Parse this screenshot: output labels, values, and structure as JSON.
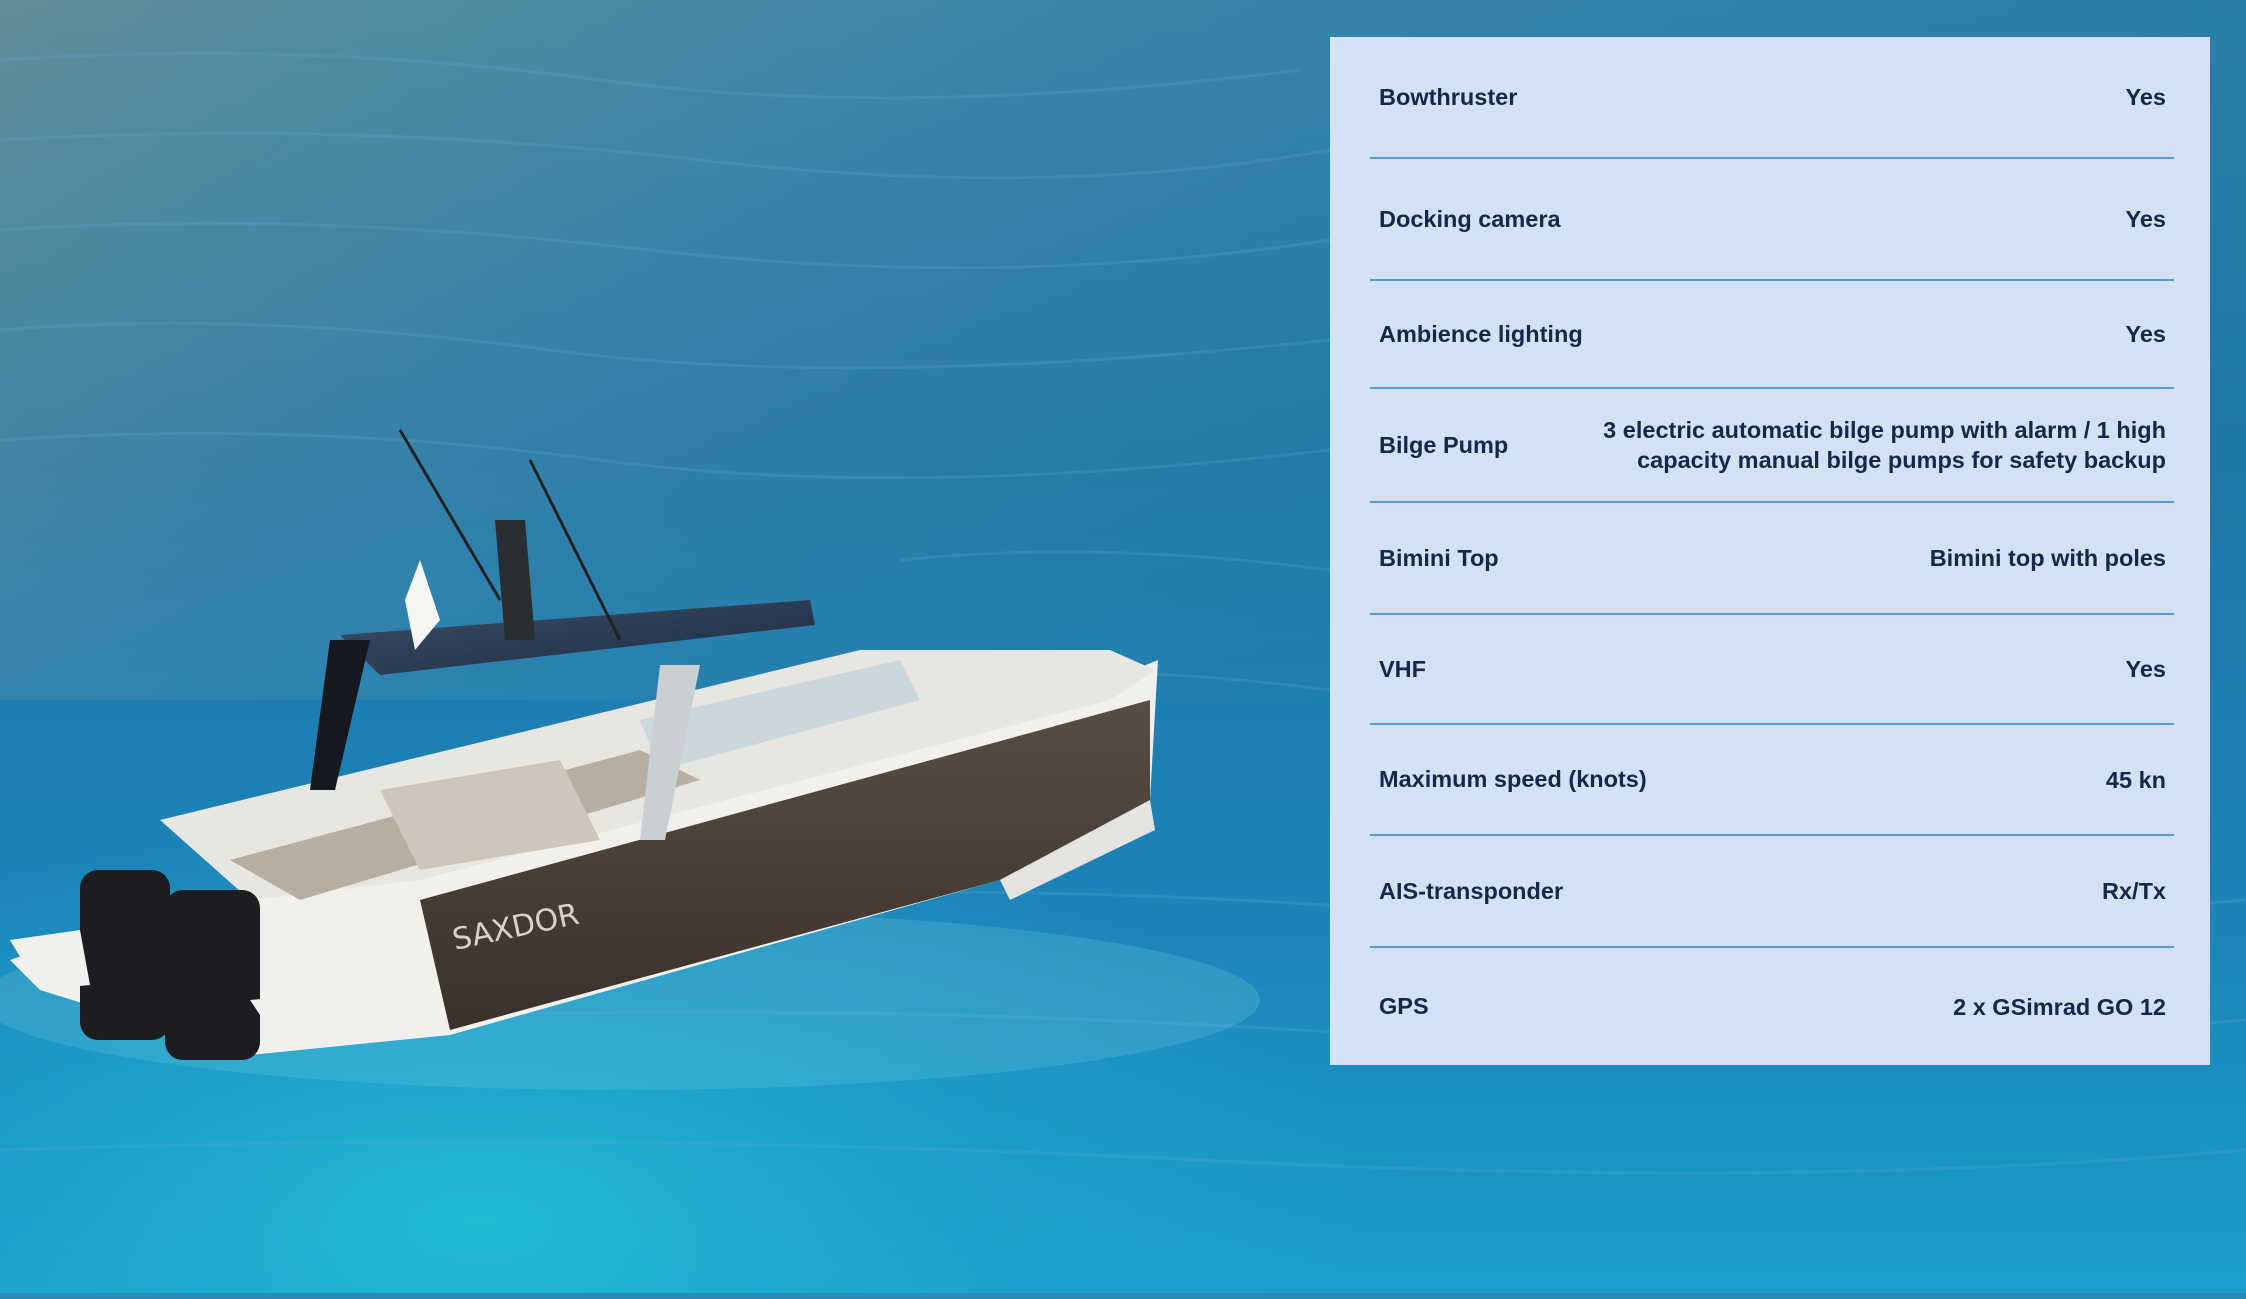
{
  "background": {
    "image": "aerial-photo-motor-boat-on-sea",
    "boat_hull_lettering": "SAXDOR",
    "colors": {
      "sea_deep": "#1c6f9e",
      "sea_light": "#1fb0cf",
      "hull": "#4a3f37",
      "deck": "#e8e6e1",
      "engine": "#1b1d20"
    }
  },
  "specs_panel": {
    "background_color": "#d2e1f3",
    "text_color": "#14284a",
    "divider_color": "#5c9bcf",
    "rows": [
      {
        "label": "Bowthruster",
        "value": "Yes"
      },
      {
        "label": "Docking camera",
        "value": "Yes"
      },
      {
        "label": "Ambience lighting",
        "value": "Yes"
      },
      {
        "label": "Bilge Pump",
        "value": "3 electric automatic bilge pump with alarm / 1 high\ncapacity manual bilge pumps for safety backup"
      },
      {
        "label": "Bimini Top",
        "value": "Bimini top with poles"
      },
      {
        "label": "VHF",
        "value": "Yes"
      },
      {
        "label": "Maximum speed (knots)",
        "value": "45 kn"
      },
      {
        "label": "AIS-transponder",
        "value": "Rx/Tx"
      },
      {
        "label": "GPS",
        "value": "2 x GSimrad GO 12"
      }
    ]
  }
}
